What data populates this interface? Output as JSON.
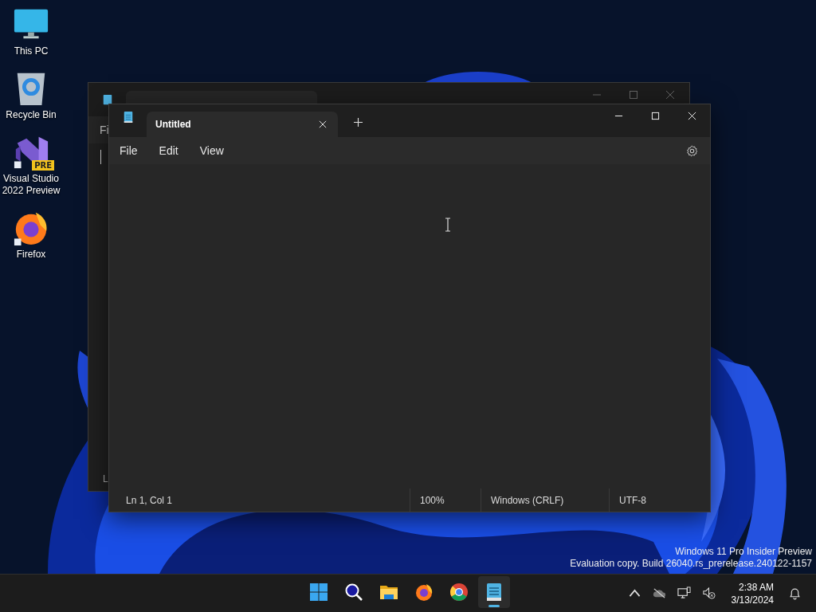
{
  "desktop_icons": [
    {
      "label": "This PC",
      "kind": "pc"
    },
    {
      "label": "Recycle Bin",
      "kind": "bin"
    },
    {
      "label": "Visual Studio 2022 Preview",
      "kind": "vs",
      "badge": "PRE"
    },
    {
      "label": "Firefox",
      "kind": "firefox"
    }
  ],
  "back_window": {
    "menu_label": "Fi",
    "status_label": "L"
  },
  "window": {
    "tab": {
      "title": "Untitled",
      "selected": true
    },
    "menu": [
      "File",
      "Edit",
      "View"
    ],
    "status_bar": [
      "Ln 1, Col 1",
      "100%",
      "Windows (CRLF)",
      "UTF-8"
    ]
  },
  "watermark": [
    "Windows 11 Pro Insider Preview",
    "Evaluation copy. Build 26040.rs_prerelease.240122-1157"
  ],
  "taskbar": {
    "apps": [
      {
        "kind": "start",
        "selected": false
      },
      {
        "kind": "search",
        "selected": false
      },
      {
        "kind": "explorer",
        "selected": false
      },
      {
        "kind": "firefox",
        "selected": false
      },
      {
        "kind": "chrome",
        "selected": false
      },
      {
        "kind": "notepad",
        "selected": true
      }
    ],
    "time": "2:38 AM",
    "date": "3/13/2024"
  }
}
